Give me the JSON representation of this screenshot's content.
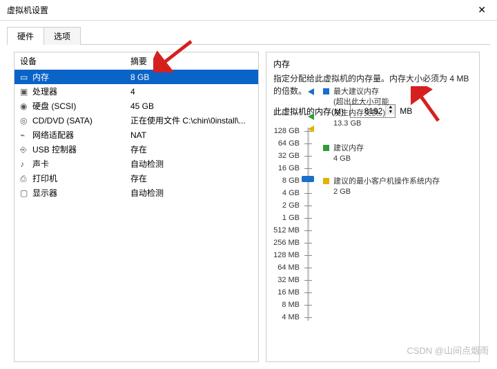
{
  "window": {
    "title": "虚拟机设置"
  },
  "tabs": {
    "hardware": "硬件",
    "options": "选项"
  },
  "table": {
    "col_device": "设备",
    "col_summary": "摘要",
    "rows": [
      {
        "icon": "▭",
        "name": "内存",
        "summary": "8 GB",
        "selected": true
      },
      {
        "icon": "▣",
        "name": "处理器",
        "summary": "4"
      },
      {
        "icon": "◉",
        "name": "硬盘 (SCSI)",
        "summary": "45 GB"
      },
      {
        "icon": "◎",
        "name": "CD/DVD (SATA)",
        "summary": "正在使用文件 C:\\chin\\0install\\..."
      },
      {
        "icon": "⌁",
        "name": "网络适配器",
        "summary": "NAT"
      },
      {
        "icon": "⎆",
        "name": "USB 控制器",
        "summary": "存在"
      },
      {
        "icon": "♪",
        "name": "声卡",
        "summary": "自动检测"
      },
      {
        "icon": "⎙",
        "name": "打印机",
        "summary": "存在"
      },
      {
        "icon": "▢",
        "name": "显示器",
        "summary": "自动检测"
      }
    ]
  },
  "memory": {
    "title": "内存",
    "desc": "指定分配给此虚拟机的内存量。内存大小必须为 4 MB 的倍数。",
    "label": "此虚拟机的内存(M):",
    "value": "8192",
    "unit": "MB",
    "ticks": [
      "128 GB",
      "64 GB",
      "32 GB",
      "16 GB",
      "8 GB",
      "4 GB",
      "2 GB",
      "1 GB",
      "512 MB",
      "256 MB",
      "128 MB",
      "64 MB",
      "32 MB",
      "16 MB",
      "8 MB",
      "4 MB"
    ],
    "max_label": "最大建议内存",
    "max_note1": "(超出此大小可能",
    "max_note2": "发生内存交换。)",
    "max_value": "13.3 GB",
    "rec_label": "建议内存",
    "rec_value": "4 GB",
    "min_label": "建议的最小客户机操作系统内存",
    "min_value": "2 GB"
  },
  "watermark": "CSDN @山间点烟雨"
}
